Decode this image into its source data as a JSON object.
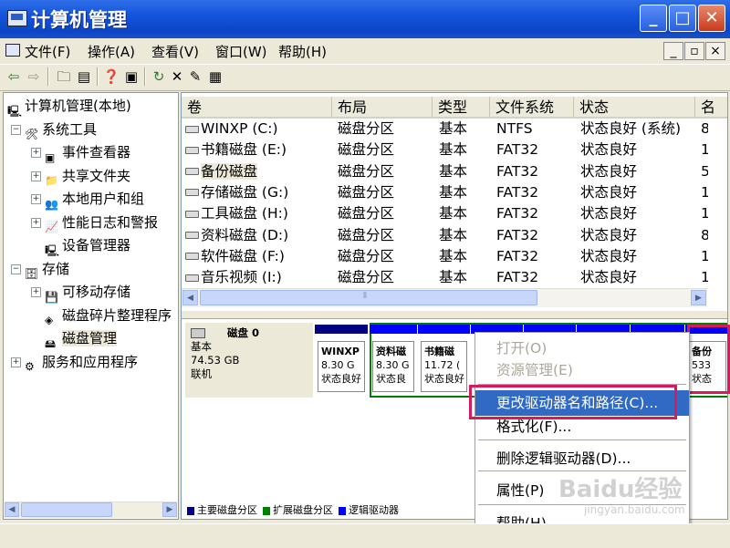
{
  "window": {
    "title": "计算机管理"
  },
  "menu": [
    "文件(F)",
    "操作(A)",
    "查看(V)",
    "窗口(W)",
    "帮助(H)"
  ],
  "mdi_controls": [
    "_",
    "▫",
    "×"
  ],
  "toolbar": [
    "back-icon",
    "forward-icon",
    "up-icon",
    "show-tree-icon",
    "properties-icon",
    "help-icon",
    "refresh-icon",
    "delete-icon",
    "settings-icon",
    "extra-icon"
  ],
  "tree": {
    "items": [
      {
        "label": "计算机管理(本地)",
        "level": 0,
        "expander": "",
        "icon": "computer-icon"
      },
      {
        "label": "系统工具",
        "level": 1,
        "expander": "−",
        "icon": "tools-icon"
      },
      {
        "label": "事件查看器",
        "level": 2,
        "expander": "+",
        "icon": "event-viewer-icon"
      },
      {
        "label": "共享文件夹",
        "level": 2,
        "expander": "+",
        "icon": "shared-folder-icon"
      },
      {
        "label": "本地用户和组",
        "level": 2,
        "expander": "+",
        "icon": "users-icon"
      },
      {
        "label": "性能日志和警报",
        "level": 2,
        "expander": "+",
        "icon": "performance-icon"
      },
      {
        "label": "设备管理器",
        "level": 2,
        "expander": "",
        "icon": "device-manager-icon"
      },
      {
        "label": "存储",
        "level": 1,
        "expander": "−",
        "icon": "storage-icon"
      },
      {
        "label": "可移动存储",
        "level": 2,
        "expander": "+",
        "icon": "removable-storage-icon"
      },
      {
        "label": "磁盘碎片整理程序",
        "level": 2,
        "expander": "",
        "icon": "defrag-icon"
      },
      {
        "label": "磁盘管理",
        "level": 2,
        "expander": "",
        "icon": "disk-management-icon",
        "selected": true
      },
      {
        "label": "服务和应用程序",
        "level": 1,
        "expander": "+",
        "icon": "services-icon"
      }
    ]
  },
  "volumes": {
    "columns": [
      "卷",
      "布局",
      "类型",
      "文件系统",
      "状态",
      "名"
    ],
    "rows": [
      [
        "WINXP (C:)",
        "磁盘分区",
        "基本",
        "NTFS",
        "状态良好 (系统)",
        "8"
      ],
      [
        "书籍磁盘 (E:)",
        "磁盘分区",
        "基本",
        "FAT32",
        "状态良好",
        "1"
      ],
      [
        "备份磁盘",
        "磁盘分区",
        "基本",
        "FAT32",
        "状态良好",
        "5"
      ],
      [
        "存储磁盘 (G:)",
        "磁盘分区",
        "基本",
        "FAT32",
        "状态良好",
        "1"
      ],
      [
        "工具磁盘 (H:)",
        "磁盘分区",
        "基本",
        "FAT32",
        "状态良好",
        "1"
      ],
      [
        "资料磁盘 (D:)",
        "磁盘分区",
        "基本",
        "FAT32",
        "状态良好",
        "8"
      ],
      [
        "软件磁盘 (F:)",
        "磁盘分区",
        "基本",
        "FAT32",
        "状态良好",
        "1"
      ],
      [
        "音乐视频 (I:)",
        "磁盘分区",
        "基本",
        "FAT32",
        "状态良好",
        "1"
      ]
    ]
  },
  "disk": {
    "name": "磁盘 0",
    "type": "基本",
    "size": "74.53 GB",
    "status": "联机",
    "partitions": [
      {
        "name": "WINXP",
        "size": "8.30 G",
        "status": "状态良好"
      },
      {
        "name": "资料磁",
        "size": "8.30 G",
        "status": "状态良"
      },
      {
        "name": "书籍磁",
        "size": "11.72 (",
        "status": "状态良好"
      },
      {
        "name": "",
        "size": "",
        "status": ""
      },
      {
        "name": "",
        "size": "",
        "status": ""
      },
      {
        "name": "",
        "size": "",
        "status": ""
      },
      {
        "name": "",
        "size": "",
        "status": ""
      },
      {
        "name": "备份",
        "size": "533",
        "status": "状态"
      }
    ]
  },
  "legend": [
    {
      "label": "主要磁盘分区",
      "color": "#000080"
    },
    {
      "label": "扩展磁盘分区",
      "color": "#008000"
    },
    {
      "label": "逻辑驱动器",
      "color": "#0000ff"
    }
  ],
  "context_menu": {
    "items": [
      {
        "label": "打开(O)",
        "disabled": true
      },
      {
        "label": "资源管理(E)",
        "disabled": true
      },
      {
        "label": "更改驱动器名和路径(C)...",
        "highlighted": true
      },
      {
        "label": "格式化(F)..."
      },
      {
        "label": "删除逻辑驱动器(D)..."
      },
      {
        "label": "属性(P)"
      },
      {
        "label": "帮助(H)"
      }
    ]
  },
  "watermark": {
    "brand": "Baidu经验",
    "url": "jingyan.baidu.com"
  },
  "colors": {
    "highlight": "#316ac5",
    "annotation": "#d8195a",
    "primary": "#000080",
    "extended": "#008000",
    "logical": "#0000ff"
  }
}
